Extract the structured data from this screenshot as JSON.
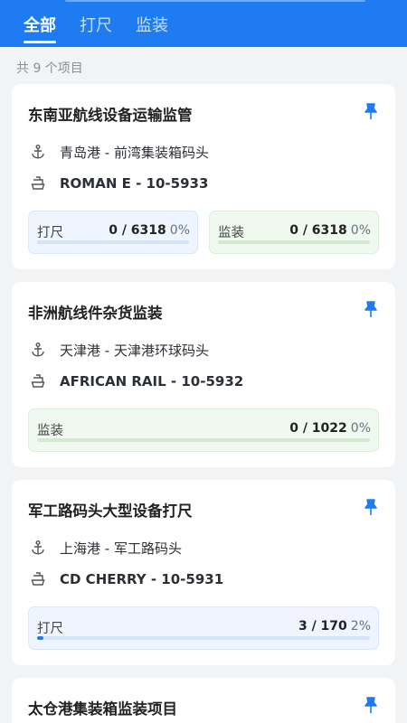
{
  "tabs": [
    "全部",
    "打尺",
    "监装"
  ],
  "count_text": "共 9 个项目",
  "colors": {
    "accent": "#1f7bf2",
    "green": "#48b04c"
  },
  "projects": [
    {
      "title": "东南亚航线设备运输监管",
      "port": "青岛港 - 前湾集装箱码头",
      "vessel": "ROMAN E - 10-5933",
      "progress": [
        {
          "label": "打尺",
          "done": "0",
          "total": "6318",
          "value": "0 / 6318",
          "pct": "0%",
          "fraction": 0
        },
        {
          "label": "监装",
          "done": "0",
          "total": "6318",
          "value": "0 / 6318",
          "pct": "0%",
          "fraction": 0
        }
      ]
    },
    {
      "title": "非洲航线件杂货监装",
      "port": "天津港 - 天津港环球码头",
      "vessel": "AFRICAN RAIL - 10-5932",
      "progress": [
        {
          "label": "监装",
          "value": "0 / 1022",
          "pct": "0%",
          "fraction": 0
        }
      ]
    },
    {
      "title": "军工路码头大型设备打尺",
      "port": "上海港 - 军工路码头",
      "vessel": "CD CHERRY - 10-5931",
      "progress": [
        {
          "label": "打尺",
          "value": "3 / 170",
          "pct": "2%",
          "fraction": 0.02
        }
      ]
    },
    {
      "title": "太仓港集装箱监装项目"
    }
  ]
}
